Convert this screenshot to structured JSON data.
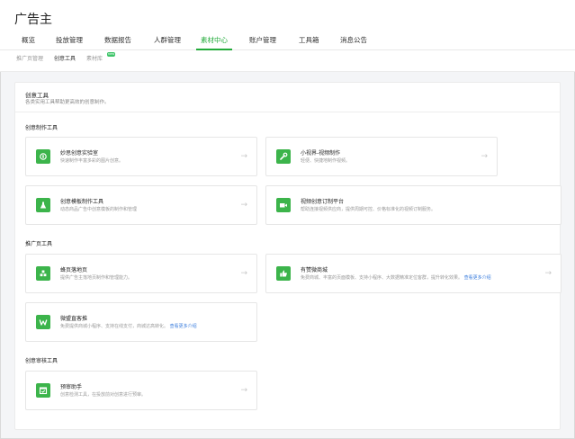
{
  "app": {
    "title": "广告主"
  },
  "nav": {
    "items": [
      {
        "label": "概览"
      },
      {
        "label": "投放管理"
      },
      {
        "label": "数据报告"
      },
      {
        "label": "人群管理"
      },
      {
        "label": "素材中心",
        "active": true
      },
      {
        "label": "账户管理"
      },
      {
        "label": "工具箱"
      },
      {
        "label": "消息公告"
      }
    ]
  },
  "subnav": {
    "items": [
      {
        "label": "推广页管理"
      },
      {
        "label": "创意工具",
        "active": true
      },
      {
        "label": "素材库"
      }
    ],
    "badge": "new"
  },
  "card": {
    "title": "创意工具",
    "desc": "各类实用工具帮助更高效的创意制作。"
  },
  "sections": [
    {
      "title": "创意制作工具",
      "tools": [
        {
          "name": "妙思创意实验室",
          "desc": "快速制作丰富多彩的图片创意。",
          "icon": "bulb-icon"
        },
        {
          "name": "小视界-视频制作",
          "desc": "轻便、快捷地制作视频。",
          "icon": "wrench-icon"
        },
        {
          "name": "创意模板制作工具",
          "desc": "动态商品广告中创意模板的制作和管理",
          "icon": "flask-icon"
        },
        {
          "name": "视频创意订制平台",
          "desc": "帮助连接视频供应商，提供周期可控、价格标准化的视频订制服务。",
          "icon": "video-camera-icon"
        }
      ]
    },
    {
      "title": "推广页工具",
      "tools": [
        {
          "name": "蜂页落地页",
          "desc": "提供广告主落地页制作和管理能力。",
          "icon": "blocks-icon"
        },
        {
          "name": "有赞微商城",
          "desc": "免费商城、丰富的页面模板、支持小程序、大数据精准定位客群，提升转化效果。",
          "link": "查看更多介绍",
          "icon": "thumbs-up-icon"
        },
        {
          "name": "微盟直客推",
          "desc": "免费提供商城小程序、支持在线支付，商城达高转化。",
          "link": "查看更多介绍",
          "icon": "w-logo-icon"
        }
      ]
    },
    {
      "title": "创意审核工具",
      "tools": [
        {
          "name": "预审助手",
          "desc": "创意检测工具，在投放前对创意进行预审。",
          "icon": "calendar-check-icon"
        }
      ]
    }
  ],
  "colors": {
    "accent": "#22ab3a",
    "icon_bg": "#3cb44b",
    "link": "#3b7ddd"
  },
  "arrow_glyph": "→"
}
